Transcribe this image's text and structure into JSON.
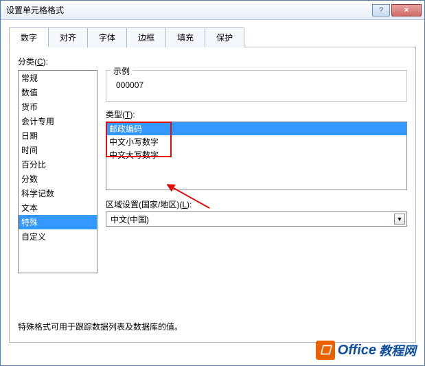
{
  "window": {
    "title": "设置单元格格式"
  },
  "tabs": [
    {
      "label": "数字"
    },
    {
      "label": "对齐"
    },
    {
      "label": "字体"
    },
    {
      "label": "边框"
    },
    {
      "label": "填充"
    },
    {
      "label": "保护"
    }
  ],
  "category": {
    "label_prefix": "分类(",
    "label_key": "C",
    "label_suffix": "):",
    "items": [
      "常规",
      "数值",
      "货币",
      "会计专用",
      "日期",
      "时间",
      "百分比",
      "分数",
      "科学记数",
      "文本",
      "特殊",
      "自定义"
    ],
    "selected": "特殊"
  },
  "sample": {
    "label": "示例",
    "value": "000007"
  },
  "type": {
    "label_prefix": "类型(",
    "label_key": "T",
    "label_suffix": "):",
    "items": [
      "邮政编码",
      "中文小写数字",
      "中文大写数字"
    ],
    "selected": "邮政编码"
  },
  "locale": {
    "label_prefix": "区域设置(国家/地区)(",
    "label_key": "L",
    "label_suffix": "):",
    "value": "中文(中国)"
  },
  "description": "特殊格式可用于跟踪数据列表及数据库的值。",
  "buttons": {
    "help": "?",
    "close": "×"
  },
  "watermark": {
    "brand": "Office",
    "sub": "教程网"
  }
}
